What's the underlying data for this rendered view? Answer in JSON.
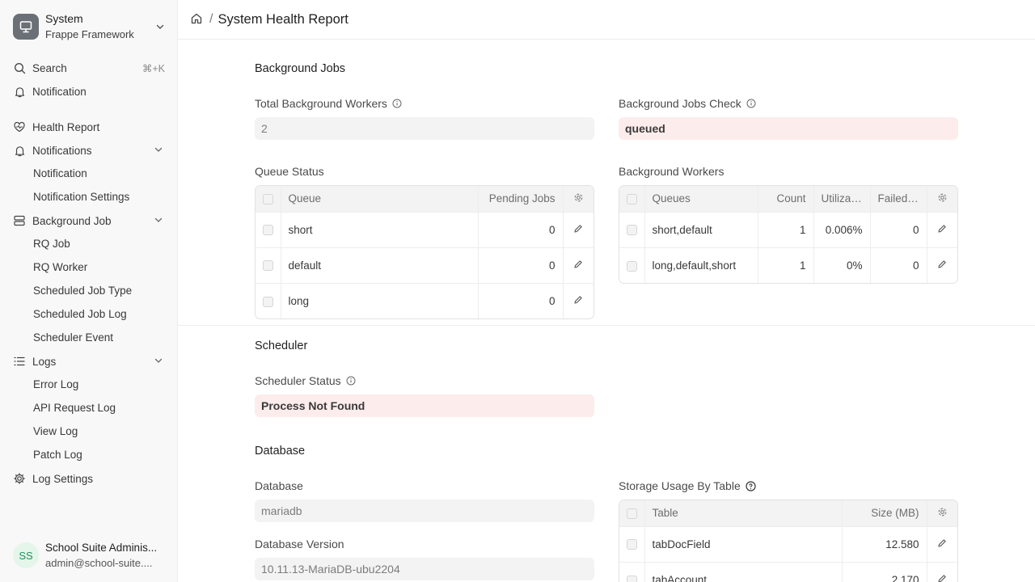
{
  "app": {
    "name": "System",
    "subtitle": "Frappe Framework"
  },
  "sidebar": {
    "search_label": "Search",
    "search_shortcut": "⌘+K",
    "notification_label": "Notification",
    "items": [
      {
        "label": "Health Report",
        "icon": "heart-icon"
      },
      {
        "label": "Notifications",
        "icon": "bell-icon",
        "children": [
          "Notification",
          "Notification Settings"
        ]
      },
      {
        "label": "Background Job",
        "icon": "database-icon",
        "children": [
          "RQ Job",
          "RQ Worker",
          "Scheduled Job Type",
          "Scheduled Job Log",
          "Scheduler Event"
        ]
      },
      {
        "label": "Logs",
        "icon": "list-icon",
        "children": [
          "Error Log",
          "API Request Log",
          "View Log",
          "Patch Log"
        ]
      },
      {
        "label": "Log Settings",
        "icon": "gear-icon"
      }
    ]
  },
  "user": {
    "initials": "SS",
    "name": "School Suite Adminis...",
    "email": "admin@school-suite...."
  },
  "header": {
    "title": "System Health Report"
  },
  "background_jobs": {
    "section_title": "Background Jobs",
    "total_workers_label": "Total Background Workers",
    "total_workers_value": "2",
    "jobs_check_label": "Background Jobs Check",
    "jobs_check_value": "queued",
    "queue_status": {
      "label": "Queue Status",
      "columns": [
        "Queue",
        "Pending Jobs"
      ],
      "rows": [
        {
          "queue": "short",
          "pending": "0"
        },
        {
          "queue": "default",
          "pending": "0"
        },
        {
          "queue": "long",
          "pending": "0"
        }
      ]
    },
    "workers": {
      "label": "Background Workers",
      "columns": [
        "Queues",
        "Count",
        "Utilizat...",
        "Failed ..."
      ],
      "rows": [
        {
          "queues": "short,default",
          "count": "1",
          "util": "0.006%",
          "failed": "0"
        },
        {
          "queues": "long,default,short",
          "count": "1",
          "util": "0%",
          "failed": "0"
        }
      ]
    }
  },
  "scheduler": {
    "section_title": "Scheduler",
    "status_label": "Scheduler Status",
    "status_value": "Process Not Found"
  },
  "database": {
    "section_title": "Database",
    "db_label": "Database",
    "db_value": "mariadb",
    "version_label": "Database Version",
    "version_value": "10.11.13-MariaDB-ubu2204",
    "storage": {
      "label": "Storage Usage By Table",
      "columns": [
        "Table",
        "Size (MB)"
      ],
      "rows": [
        {
          "table": "tabDocField",
          "size": "12.580"
        },
        {
          "table": "tabAccount",
          "size": "2.170"
        }
      ]
    }
  },
  "colors": {
    "danger_bg": "#fdecec",
    "field_bg": "#f3f3f3",
    "avatar_bg": "#e4f5e9"
  }
}
